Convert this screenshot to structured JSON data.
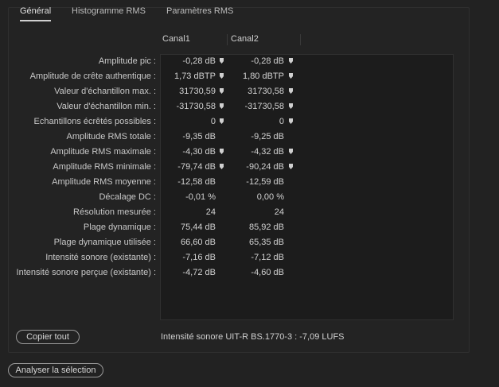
{
  "tabs": [
    {
      "label": "Général",
      "active": true
    },
    {
      "label": "Histogramme RMS",
      "active": false
    },
    {
      "label": "Paramètres RMS",
      "active": false
    }
  ],
  "columns": [
    "Canal1",
    "Canal2"
  ],
  "rows": [
    {
      "label": "Amplitude pic :",
      "c1": "-0,28 dB",
      "c2": "-0,28 dB",
      "m1": true,
      "m2": true
    },
    {
      "label": "Amplitude de crête authentique :",
      "c1": "1,73 dBTP",
      "c2": "1,80 dBTP",
      "m1": true,
      "m2": true
    },
    {
      "label": "Valeur d'échantillon max. :",
      "c1": "31730,59",
      "c2": "31730,58",
      "m1": true,
      "m2": true
    },
    {
      "label": "Valeur d'échantillon min. :",
      "c1": "-31730,58",
      "c2": "-31730,58",
      "m1": true,
      "m2": true
    },
    {
      "label": "Echantillons écrêtés possibles :",
      "c1": "0",
      "c2": "0",
      "m1": true,
      "m2": true
    },
    {
      "label": "Amplitude RMS totale :",
      "c1": "-9,35 dB",
      "c2": "-9,25 dB",
      "m1": false,
      "m2": false
    },
    {
      "label": "Amplitude RMS maximale :",
      "c1": "-4,30 dB",
      "c2": "-4,32 dB",
      "m1": true,
      "m2": true
    },
    {
      "label": "Amplitude RMS minimale :",
      "c1": "-79,74 dB",
      "c2": "-90,24 dB",
      "m1": true,
      "m2": true
    },
    {
      "label": "Amplitude RMS moyenne :",
      "c1": "-12,58 dB",
      "c2": "-12,59 dB",
      "m1": false,
      "m2": false
    },
    {
      "label": "Décalage DC :",
      "c1": "-0,01 %",
      "c2": "0,00 %",
      "m1": false,
      "m2": false
    },
    {
      "label": "Résolution mesurée :",
      "c1": "24",
      "c2": "24",
      "m1": false,
      "m2": false
    },
    {
      "label": "Plage dynamique :",
      "c1": "75,44 dB",
      "c2": "85,92 dB",
      "m1": false,
      "m2": false
    },
    {
      "label": "Plage dynamique utilisée :",
      "c1": "66,60 dB",
      "c2": "65,35 dB",
      "m1": false,
      "m2": false
    },
    {
      "label": "Intensité sonore (existante) :",
      "c1": "-7,16 dB",
      "c2": "-7,12 dB",
      "m1": false,
      "m2": false
    },
    {
      "label": "Intensité sonore perçue (existante) :",
      "c1": "-4,72 dB",
      "c2": "-4,60 dB",
      "m1": false,
      "m2": false
    }
  ],
  "copy_button": "Copier tout",
  "loudness_text": "Intensité sonore UIT-R BS.1770-3 :  -7,09 LUFS",
  "analyze_button": "Analyser la sélection",
  "colors": {
    "background": "#222222",
    "table_background": "#1c1c1c",
    "text": "#c8c8c8",
    "marker": "#d0d0d0"
  },
  "icons": {
    "marker": "location-pin-icon"
  }
}
